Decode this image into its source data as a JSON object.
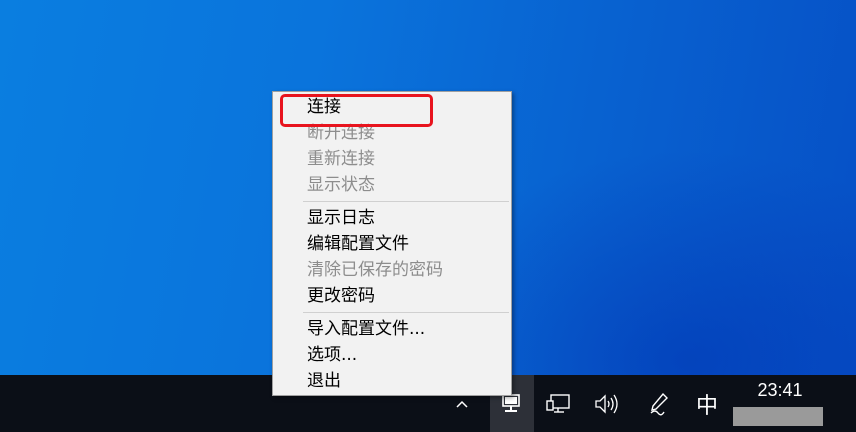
{
  "context_menu": {
    "items": [
      {
        "label": "连接",
        "enabled": true
      },
      {
        "label": "断开连接",
        "enabled": false
      },
      {
        "label": "重新连接",
        "enabled": false
      },
      {
        "label": "显示状态",
        "enabled": false
      },
      {
        "label": "显示日志",
        "enabled": true
      },
      {
        "label": "编辑配置文件",
        "enabled": true
      },
      {
        "label": "清除已保存的密码",
        "enabled": false
      },
      {
        "label": "更改密码",
        "enabled": true
      },
      {
        "label": "导入配置文件...",
        "enabled": true
      },
      {
        "label": "选项...",
        "enabled": true
      },
      {
        "label": "退出",
        "enabled": true
      }
    ],
    "highlighted_item": "连接",
    "highlight_color": "#e8141e"
  },
  "taskbar": {
    "ime_indicator": "中",
    "clock_time": "23:41",
    "tray_icons": [
      "chevron-up-icon",
      "openvpn-monitor-icon",
      "network-icon",
      "volume-icon",
      "pen-icon"
    ]
  }
}
